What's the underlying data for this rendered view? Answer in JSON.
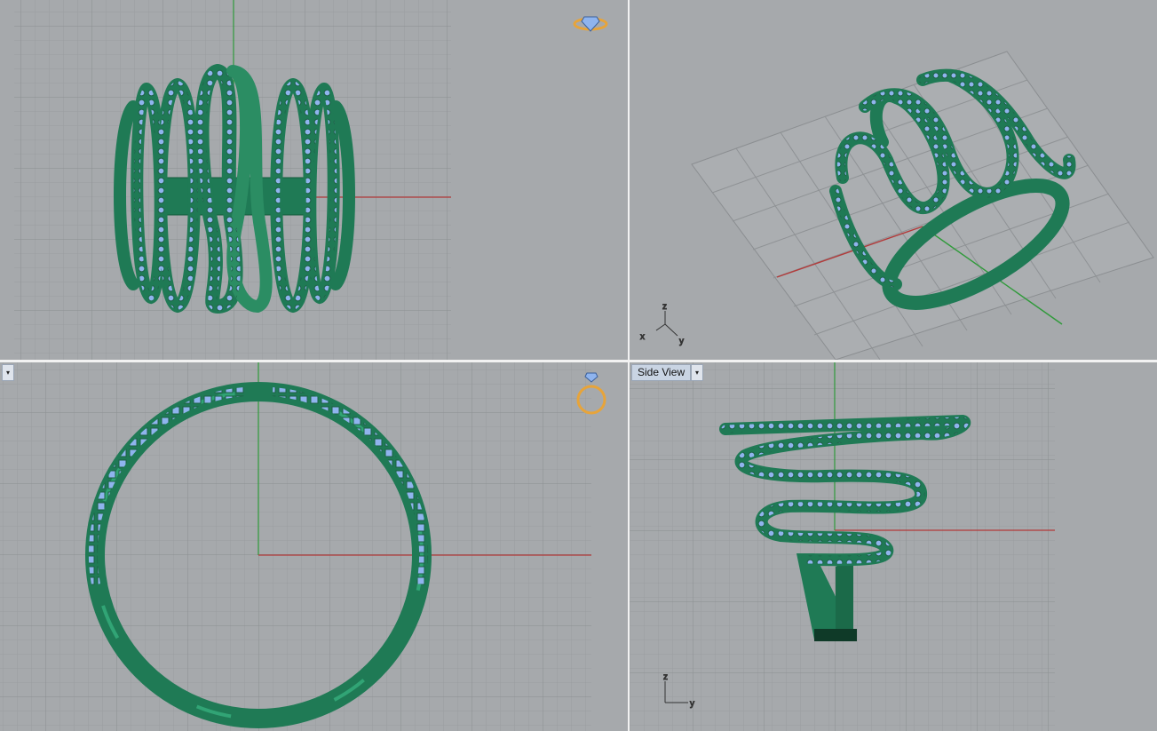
{
  "viewports": {
    "front": {
      "label": ""
    },
    "perspective": {
      "label": ""
    },
    "top": {
      "label": ""
    },
    "side": {
      "label": "Side View",
      "menu_arrow": "▾"
    }
  },
  "axis_labels": {
    "x": "x",
    "y": "y",
    "z": "z"
  },
  "colors": {
    "viewport_bg": "#a6a9ac",
    "grid_minor": "#9a9da0",
    "grid_major": "#8b8e91",
    "axis_x": "#b23a3a",
    "axis_y": "#2f9a3a",
    "model_body": "#1f7a55",
    "model_highlight": "#3ec08a",
    "gem": "#8fb4ee",
    "gizmo": "#e7a43a"
  },
  "icons": [
    "ring-gem-gizmo-icon",
    "ring-top-gizmo-icon",
    "viewport-menu-arrow-icon"
  ]
}
